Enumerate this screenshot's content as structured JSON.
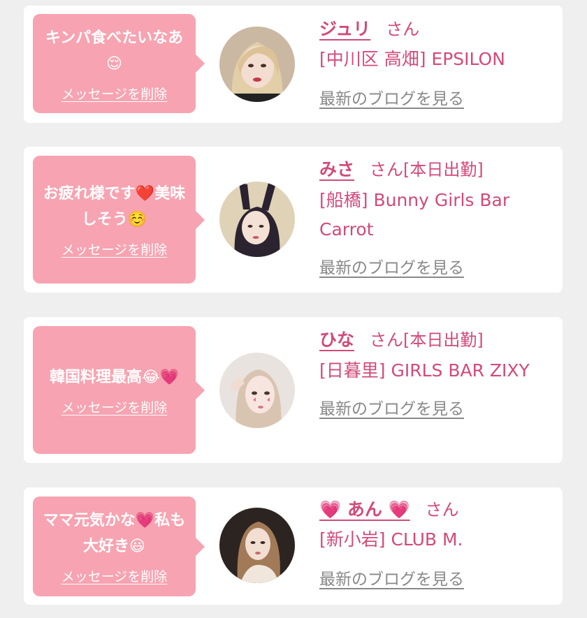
{
  "cards": [
    {
      "message": "キンパ食べたいなあ😌",
      "delete_label": "メッセージを削除",
      "name": "ジュリ",
      "honorific": "さん",
      "status": "",
      "shop": "[中川区 高畑] EPSILON",
      "blog_label": "最新のブログを見る"
    },
    {
      "message": "お疲れ様です❤️美味しそう☺️",
      "delete_label": "メッセージを削除",
      "name": "みさ",
      "honorific": "さん",
      "status": "[本日出勤]",
      "shop": "[船橋] Bunny Girls Bar Carrot",
      "blog_label": "最新のブログを見る"
    },
    {
      "message": "韓国料理最高😂💗",
      "delete_label": "メッセージを削除",
      "name": "ひな",
      "honorific": "さん",
      "status": "[本日出勤]",
      "shop": "[日暮里] GIRLS BAR ZIXY",
      "blog_label": "最新のブログを見る"
    },
    {
      "message": "ママ元気かな💗私も大好き😃",
      "delete_label": "メッセージを削除",
      "name": "💗 あん 💗",
      "honorific": "さん",
      "status": "",
      "shop": "[新小岩] CLUB M.",
      "blog_label": "最新のブログを見る"
    }
  ],
  "colors": {
    "accent": "#d24a78",
    "bubble": "#f7a3b1",
    "link_gray": "#888888",
    "background": "#efefef"
  }
}
